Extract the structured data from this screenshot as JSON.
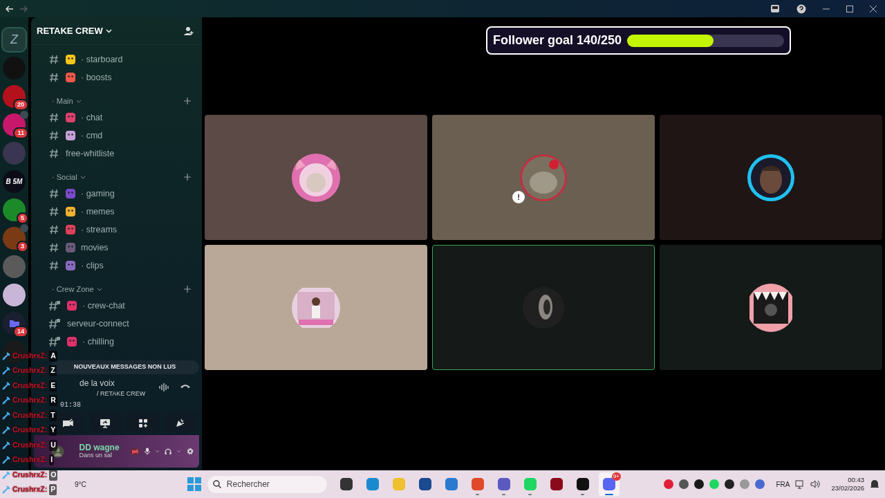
{
  "servers": [
    {
      "color": "#1f3b38",
      "selected": true,
      "logo": "Z"
    },
    {
      "color": "#111111",
      "selected": false
    },
    {
      "color": "#b3121c",
      "selected": false,
      "badge": "20"
    },
    {
      "color": "#c8186c",
      "selected": false,
      "badge": "11",
      "voice": true
    },
    {
      "color": "#3a3550",
      "selected": false
    },
    {
      "color": "#0c0c18",
      "selected": false,
      "label": "B 5M"
    },
    {
      "color": "#1d8a2a",
      "selected": false,
      "badge": "5"
    },
    {
      "color": "#7a3a14",
      "selected": false,
      "badge": "3",
      "voice": true
    },
    {
      "color": "#5a5a5a",
      "selected": false
    },
    {
      "color": "#c9b6d6",
      "selected": false
    },
    {
      "color": "#1a2030",
      "selected": false,
      "badge": "14",
      "folder": true
    },
    {
      "color": "#1a1a1a",
      "selected": false
    }
  ],
  "server_name": "RETAKE CREW",
  "channels": [
    {
      "kind": "channel",
      "label": "· starboard",
      "color": "#f5c518"
    },
    {
      "kind": "channel",
      "label": "· boosts",
      "color": "#f0584a"
    },
    {
      "kind": "category",
      "label": "· Main"
    },
    {
      "kind": "channel",
      "label": "· chat",
      "color": "#e0406a"
    },
    {
      "kind": "channel",
      "label": "· cmd",
      "color": "#c7a0d8"
    },
    {
      "kind": "channel",
      "label": "free-whitliste"
    },
    {
      "kind": "category",
      "label": "· Social"
    },
    {
      "kind": "channel",
      "label": "· gaming",
      "color": "#7a4ac8"
    },
    {
      "kind": "channel",
      "label": "· memes",
      "color": "#f0b030"
    },
    {
      "kind": "channel",
      "label": "· streams",
      "color": "#e0405a"
    },
    {
      "kind": "channel",
      "label": "movies",
      "color": "#6a5a7a"
    },
    {
      "kind": "channel",
      "label": "· clips",
      "color": "#8a6ac0"
    },
    {
      "kind": "category",
      "label": "· Crew Zone"
    },
    {
      "kind": "channel",
      "label": "· crew-chat",
      "color": "#e0306a",
      "locked": true
    },
    {
      "kind": "channel",
      "label": "serveur-connect",
      "locked": true
    },
    {
      "kind": "channel",
      "label": "· chilling",
      "color": "#e0306a",
      "locked": true
    }
  ],
  "unread_banner": "NOUVEAUX MESSAGES NON LUS",
  "voice_panel": {
    "title": "de la voix",
    "channel": "/ RETAKE CREW",
    "timer": "01:38"
  },
  "user_panel": {
    "name": "DD wagne",
    "status": "Dans un sal",
    "camera_off": true
  },
  "goal": {
    "label": "Follower goal 140/250",
    "level": 0.55
  },
  "tiles": [
    {
      "color": "#5b4a45",
      "selected": false
    },
    {
      "color": "#6b5f52",
      "selected": false,
      "avatar_badge": "!"
    },
    {
      "color": "#1e1514",
      "selected": false
    },
    {
      "color": "#b9a898",
      "selected": false
    },
    {
      "color": "#151917",
      "selected": true
    },
    {
      "color": "#131a18",
      "selected": false
    }
  ],
  "overlay_chat": [
    {
      "user": "CrushrxZ:",
      "message": "A"
    },
    {
      "user": "CrushrxZ:",
      "message": "Z"
    },
    {
      "user": "CrushrxZ:",
      "message": "E"
    },
    {
      "user": "CrushrxZ:",
      "message": "R"
    },
    {
      "user": "CrushrxZ:",
      "message": "T"
    },
    {
      "user": "CrushrxZ:",
      "message": "Y"
    },
    {
      "user": "CrushrxZ:",
      "message": "U"
    },
    {
      "user": "CrushrxZ:",
      "message": "I"
    },
    {
      "user": "CrushrxZ:",
      "message": "O"
    },
    {
      "user": "CrushrxZ:",
      "message": "P"
    }
  ],
  "taskbar": {
    "weather": "9°C",
    "search_placeholder": "Rechercher",
    "apps": [
      {
        "color": "#333333",
        "running": false,
        "selected": false
      },
      {
        "color": "#1a8ad0",
        "running": false,
        "selected": false
      },
      {
        "color": "#f0c030",
        "running": false,
        "selected": false
      },
      {
        "color": "#1a4a90",
        "running": false,
        "selected": false
      },
      {
        "color": "#2a7ad0",
        "running": false,
        "selected": false
      },
      {
        "color": "#e04a2a",
        "running": true,
        "selected": false
      },
      {
        "color": "#5a5ac0",
        "running": true,
        "selected": false
      },
      {
        "color": "#1ed760",
        "running": true,
        "selected": false
      },
      {
        "color": "#8a0a1a",
        "running": false,
        "selected": false
      },
      {
        "color": "#111111",
        "running": true,
        "selected": false
      },
      {
        "color": "#5865f2",
        "running": true,
        "selected": true,
        "badge": "9+"
      }
    ],
    "tray": [
      {
        "color": "#e0203a"
      },
      {
        "color": "#555555"
      },
      {
        "color": "#1a1a1a"
      },
      {
        "color": "#1ed760"
      },
      {
        "color": "#222222"
      },
      {
        "color": "#999999"
      },
      {
        "color": "#4a6ad0"
      }
    ],
    "language": "FRA",
    "time": "00:43",
    "date": "23/02/2026"
  }
}
